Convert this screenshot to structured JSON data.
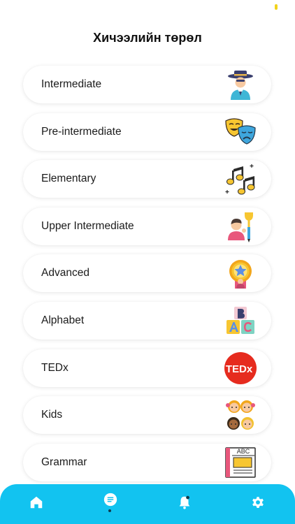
{
  "header": {
    "title": "Хичээлийн төрөл"
  },
  "lessons": [
    {
      "label": "Intermediate",
      "icon": "cowboy-icon"
    },
    {
      "label": "Pre-intermediate",
      "icon": "theater-masks-icon"
    },
    {
      "label": "Elementary",
      "icon": "music-notes-icon"
    },
    {
      "label": "Upper Intermediate",
      "icon": "student-trophy-icon"
    },
    {
      "label": "Advanced",
      "icon": "star-medal-icon"
    },
    {
      "label": "Alphabet",
      "icon": "abc-blocks-icon"
    },
    {
      "label": "TEDx",
      "icon": "tedx-logo-icon",
      "logo_text": "TEDx"
    },
    {
      "label": "Kids",
      "icon": "kids-faces-icon"
    },
    {
      "label": "Grammar",
      "icon": "abc-board-icon",
      "board_text": "ABC"
    }
  ],
  "tabbar": {
    "items": [
      {
        "name": "home",
        "icon": "home-icon",
        "active": false
      },
      {
        "name": "lessons",
        "icon": "document-icon",
        "active": true
      },
      {
        "name": "notifications",
        "icon": "bell-icon",
        "active": false
      },
      {
        "name": "settings",
        "icon": "gear-icon",
        "active": false
      }
    ]
  },
  "colors": {
    "tabbar": "#12c3f0",
    "status_accent": "#f2d31b",
    "card_bg": "#ffffff",
    "tedx_red": "#e62b1e"
  }
}
